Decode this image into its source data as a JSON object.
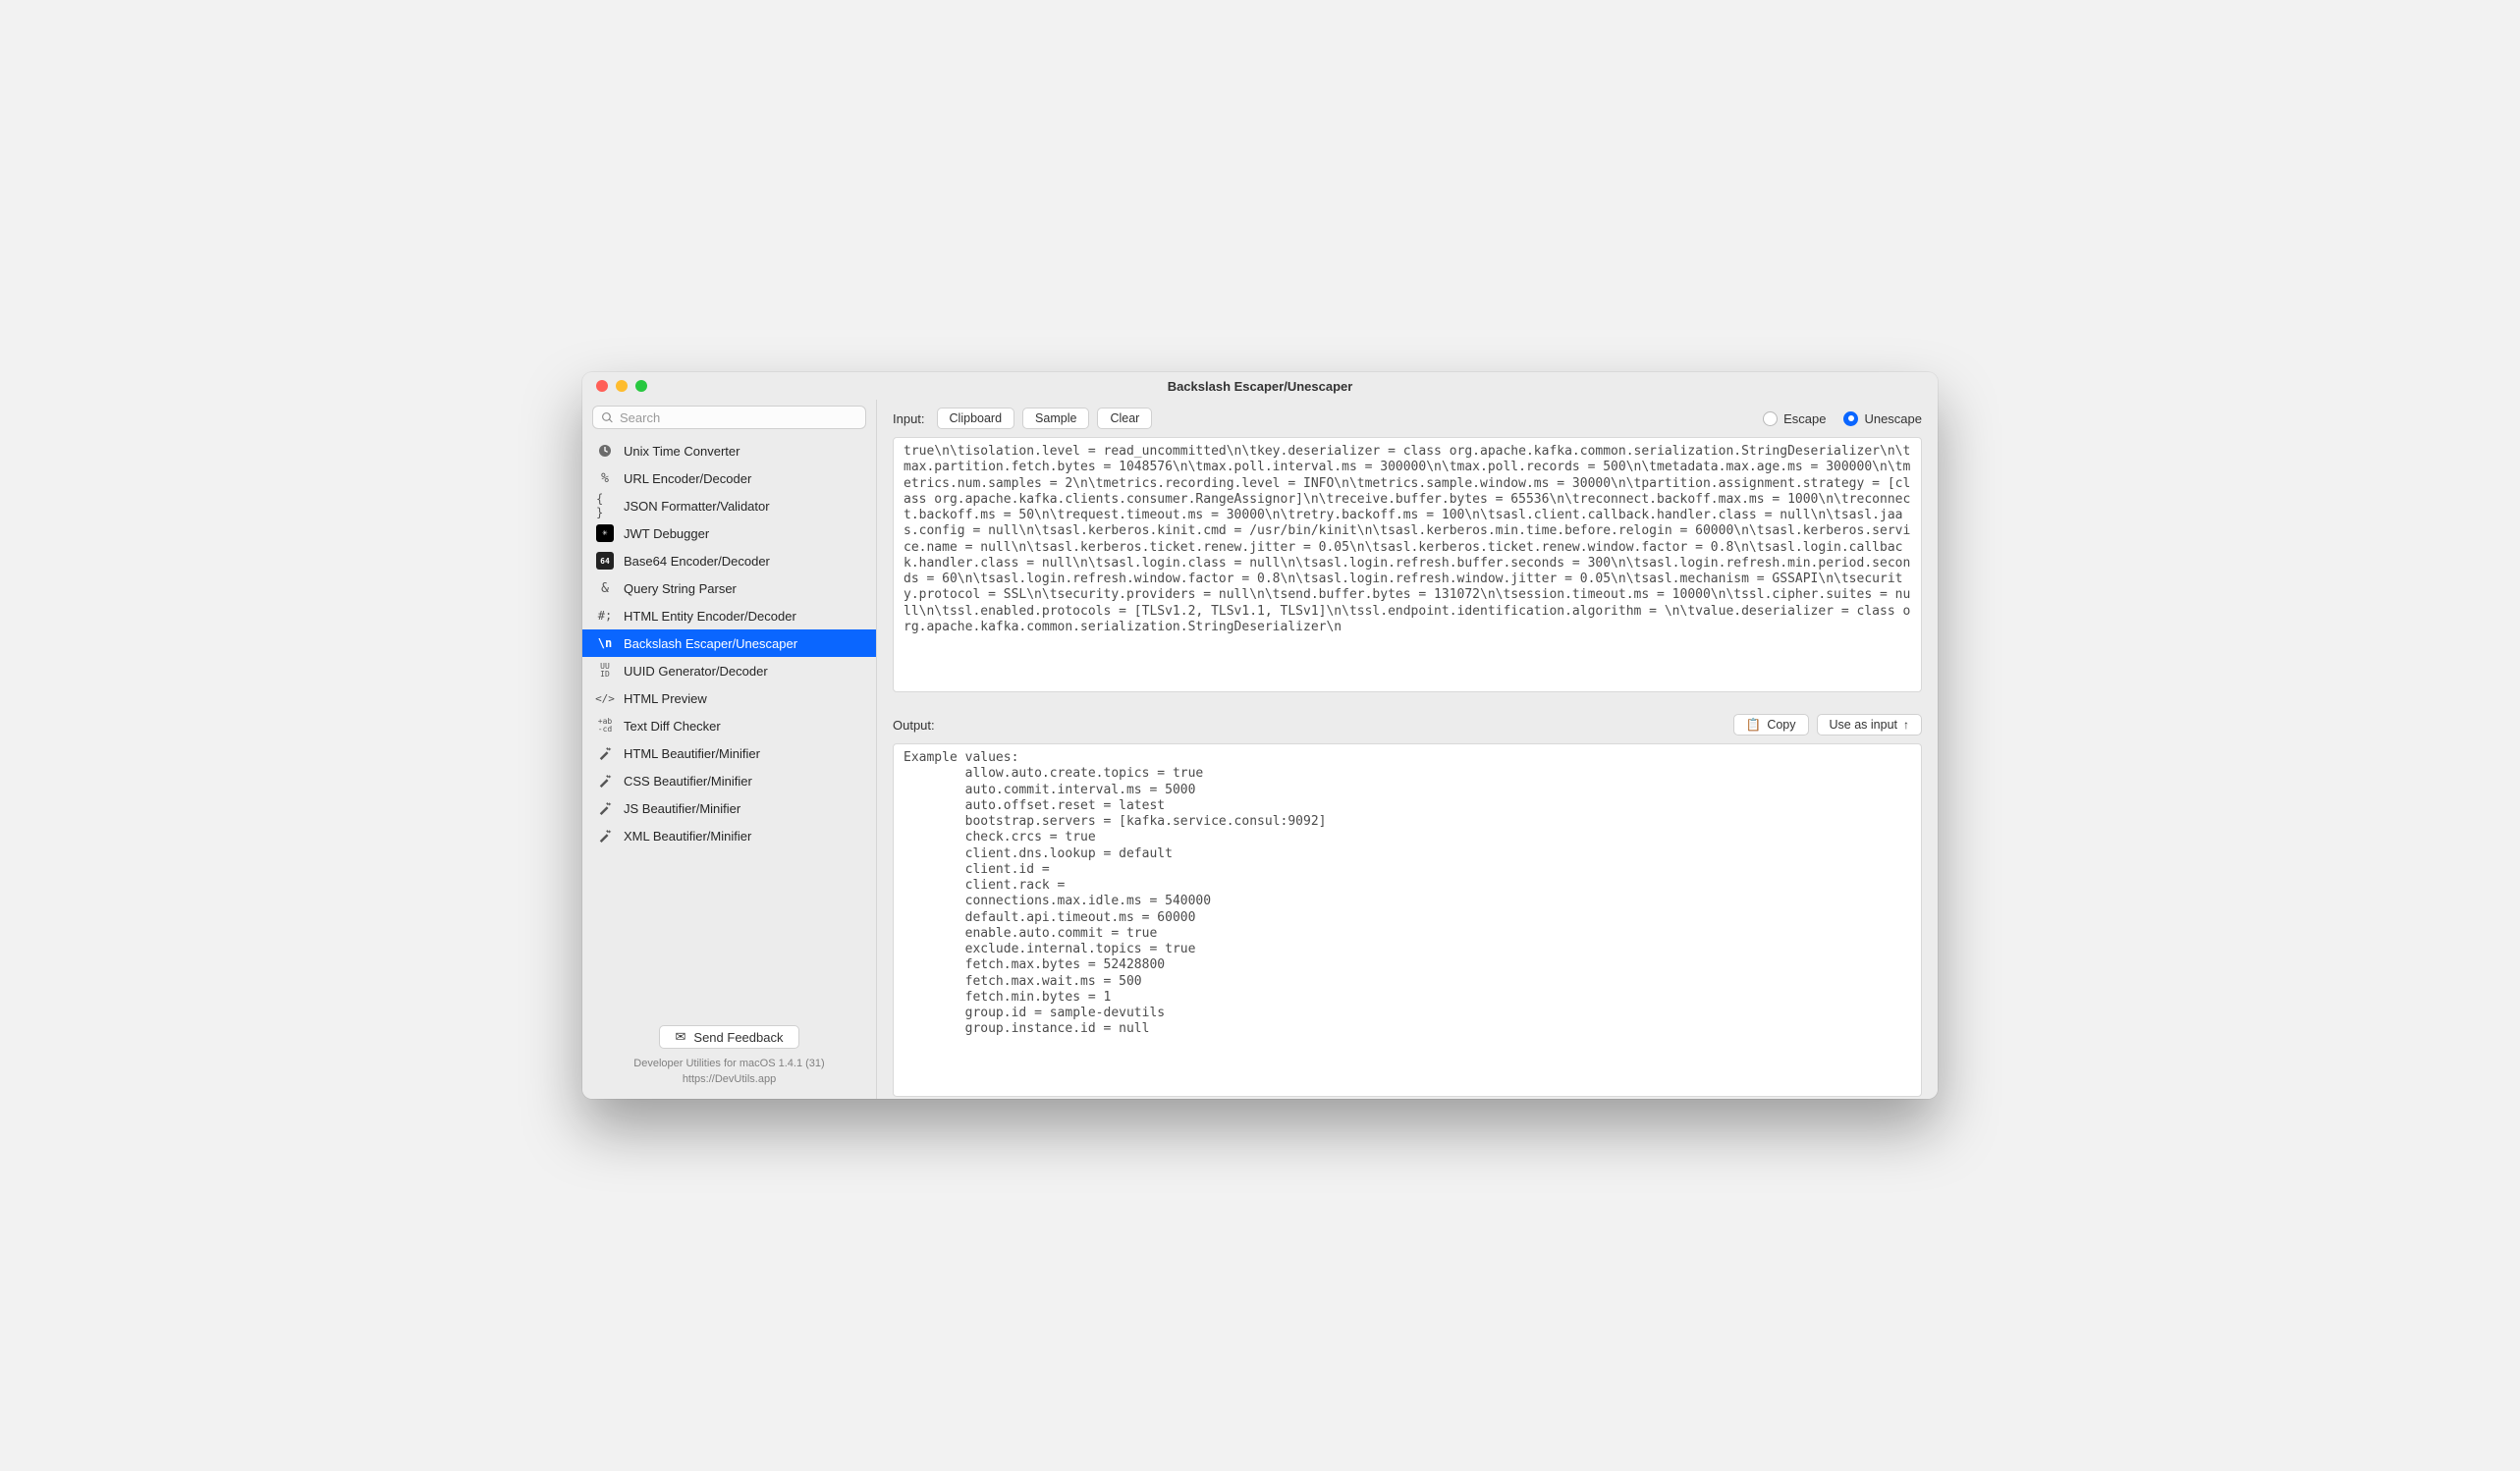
{
  "window": {
    "title": "Backslash Escaper/Unescaper"
  },
  "sidebar": {
    "search_placeholder": "Search",
    "items": [
      {
        "icon": "clock",
        "label": "Unix Time Converter"
      },
      {
        "icon": "percent",
        "label": "URL Encoder/Decoder"
      },
      {
        "icon": "braces",
        "label": "JSON Formatter/Validator"
      },
      {
        "icon": "jwt",
        "label": "JWT Debugger"
      },
      {
        "icon": "b64",
        "label": "Base64 Encoder/Decoder"
      },
      {
        "icon": "amp",
        "label": "Query String Parser"
      },
      {
        "icon": "hash",
        "label": "HTML Entity Encoder/Decoder"
      },
      {
        "icon": "bsn",
        "label": "Backslash Escaper/Unescaper"
      },
      {
        "icon": "uuid",
        "label": "UUID Generator/Decoder"
      },
      {
        "icon": "code",
        "label": "HTML Preview"
      },
      {
        "icon": "diff",
        "label": "Text Diff Checker"
      },
      {
        "icon": "wand",
        "label": "HTML Beautifier/Minifier"
      },
      {
        "icon": "wand",
        "label": "CSS Beautifier/Minifier"
      },
      {
        "icon": "wand",
        "label": "JS Beautifier/Minifier"
      },
      {
        "icon": "wand",
        "label": "XML Beautifier/Minifier"
      }
    ],
    "active_index": 7,
    "feedback_label": "Send Feedback",
    "footer_line1": "Developer Utilities for macOS 1.4.1 (31)",
    "footer_line2": "https://DevUtils.app"
  },
  "input_panel": {
    "label": "Input:",
    "buttons": {
      "clipboard": "Clipboard",
      "sample": "Sample",
      "clear": "Clear"
    },
    "radios": {
      "escape": "Escape",
      "unescape": "Unescape",
      "selected": "unescape"
    },
    "text": "true\\n\\tisolation.level = read_uncommitted\\n\\tkey.deserializer = class org.apache.kafka.common.serialization.StringDeserializer\\n\\tmax.partition.fetch.bytes = 1048576\\n\\tmax.poll.interval.ms = 300000\\n\\tmax.poll.records = 500\\n\\tmetadata.max.age.ms = 300000\\n\\tmetrics.num.samples = 2\\n\\tmetrics.recording.level = INFO\\n\\tmetrics.sample.window.ms = 30000\\n\\tpartition.assignment.strategy = [class org.apache.kafka.clients.consumer.RangeAssignor]\\n\\treceive.buffer.bytes = 65536\\n\\treconnect.backoff.max.ms = 1000\\n\\treconnect.backoff.ms = 50\\n\\trequest.timeout.ms = 30000\\n\\tretry.backoff.ms = 100\\n\\tsasl.client.callback.handler.class = null\\n\\tsasl.jaas.config = null\\n\\tsasl.kerberos.kinit.cmd = /usr/bin/kinit\\n\\tsasl.kerberos.min.time.before.relogin = 60000\\n\\tsasl.kerberos.service.name = null\\n\\tsasl.kerberos.ticket.renew.jitter = 0.05\\n\\tsasl.kerberos.ticket.renew.window.factor = 0.8\\n\\tsasl.login.callback.handler.class = null\\n\\tsasl.login.class = null\\n\\tsasl.login.refresh.buffer.seconds = 300\\n\\tsasl.login.refresh.min.period.seconds = 60\\n\\tsasl.login.refresh.window.factor = 0.8\\n\\tsasl.login.refresh.window.jitter = 0.05\\n\\tsasl.mechanism = GSSAPI\\n\\tsecurity.protocol = SSL\\n\\tsecurity.providers = null\\n\\tsend.buffer.bytes = 131072\\n\\tsession.timeout.ms = 10000\\n\\tssl.cipher.suites = null\\n\\tssl.enabled.protocols = [TLSv1.2, TLSv1.1, TLSv1]\\n\\tssl.endpoint.identification.algorithm = \\n\\tvalue.deserializer = class org.apache.kafka.common.serialization.StringDeserializer\\n"
  },
  "output_panel": {
    "label": "Output:",
    "buttons": {
      "copy": "Copy",
      "use_as_input": "Use as input"
    },
    "text": "Example values:\n\tallow.auto.create.topics = true\n\tauto.commit.interval.ms = 5000\n\tauto.offset.reset = latest\n\tbootstrap.servers = [kafka.service.consul:9092]\n\tcheck.crcs = true\n\tclient.dns.lookup = default\n\tclient.id = \n\tclient.rack = \n\tconnections.max.idle.ms = 540000\n\tdefault.api.timeout.ms = 60000\n\tenable.auto.commit = true\n\texclude.internal.topics = true\n\tfetch.max.bytes = 52428800\n\tfetch.max.wait.ms = 500\n\tfetch.min.bytes = 1\n\tgroup.id = sample-devutils\n\tgroup.instance.id = null"
  }
}
